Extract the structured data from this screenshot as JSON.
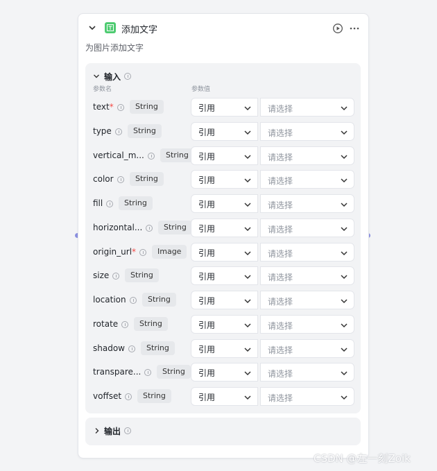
{
  "node": {
    "title": "添加文字",
    "description": "为图片添加文字"
  },
  "input_section": {
    "title": "输入",
    "col_name": "参数名",
    "col_value": "参数值",
    "params": [
      {
        "name": "text",
        "required": true,
        "type": "String",
        "source": "引用",
        "value_placeholder": "请选择"
      },
      {
        "name": "type",
        "required": false,
        "type": "String",
        "source": "引用",
        "value_placeholder": "请选择"
      },
      {
        "name": "vertical_m...",
        "required": false,
        "type": "String",
        "source": "引用",
        "value_placeholder": "请选择"
      },
      {
        "name": "color",
        "required": false,
        "type": "String",
        "source": "引用",
        "value_placeholder": "请选择"
      },
      {
        "name": "fill",
        "required": false,
        "type": "String",
        "source": "引用",
        "value_placeholder": "请选择"
      },
      {
        "name": "horizontal...",
        "required": false,
        "type": "String",
        "source": "引用",
        "value_placeholder": "请选择"
      },
      {
        "name": "origin_url",
        "required": true,
        "type": "Image",
        "source": "引用",
        "value_placeholder": "请选择"
      },
      {
        "name": "size",
        "required": false,
        "type": "String",
        "source": "引用",
        "value_placeholder": "请选择"
      },
      {
        "name": "location",
        "required": false,
        "type": "String",
        "source": "引用",
        "value_placeholder": "请选择"
      },
      {
        "name": "rotate",
        "required": false,
        "type": "String",
        "source": "引用",
        "value_placeholder": "请选择"
      },
      {
        "name": "shadow",
        "required": false,
        "type": "String",
        "source": "引用",
        "value_placeholder": "请选择"
      },
      {
        "name": "transpare...",
        "required": false,
        "type": "String",
        "source": "引用",
        "value_placeholder": "请选择"
      },
      {
        "name": "voffset",
        "required": false,
        "type": "String",
        "source": "引用",
        "value_placeholder": "请选择"
      }
    ]
  },
  "output_section": {
    "title": "输出"
  },
  "watermark": "CSDN @左一刻Zoik",
  "colors": {
    "node_icon": "#4ecb71",
    "required_mark": "#f54a45",
    "port": "#8b90e0"
  }
}
